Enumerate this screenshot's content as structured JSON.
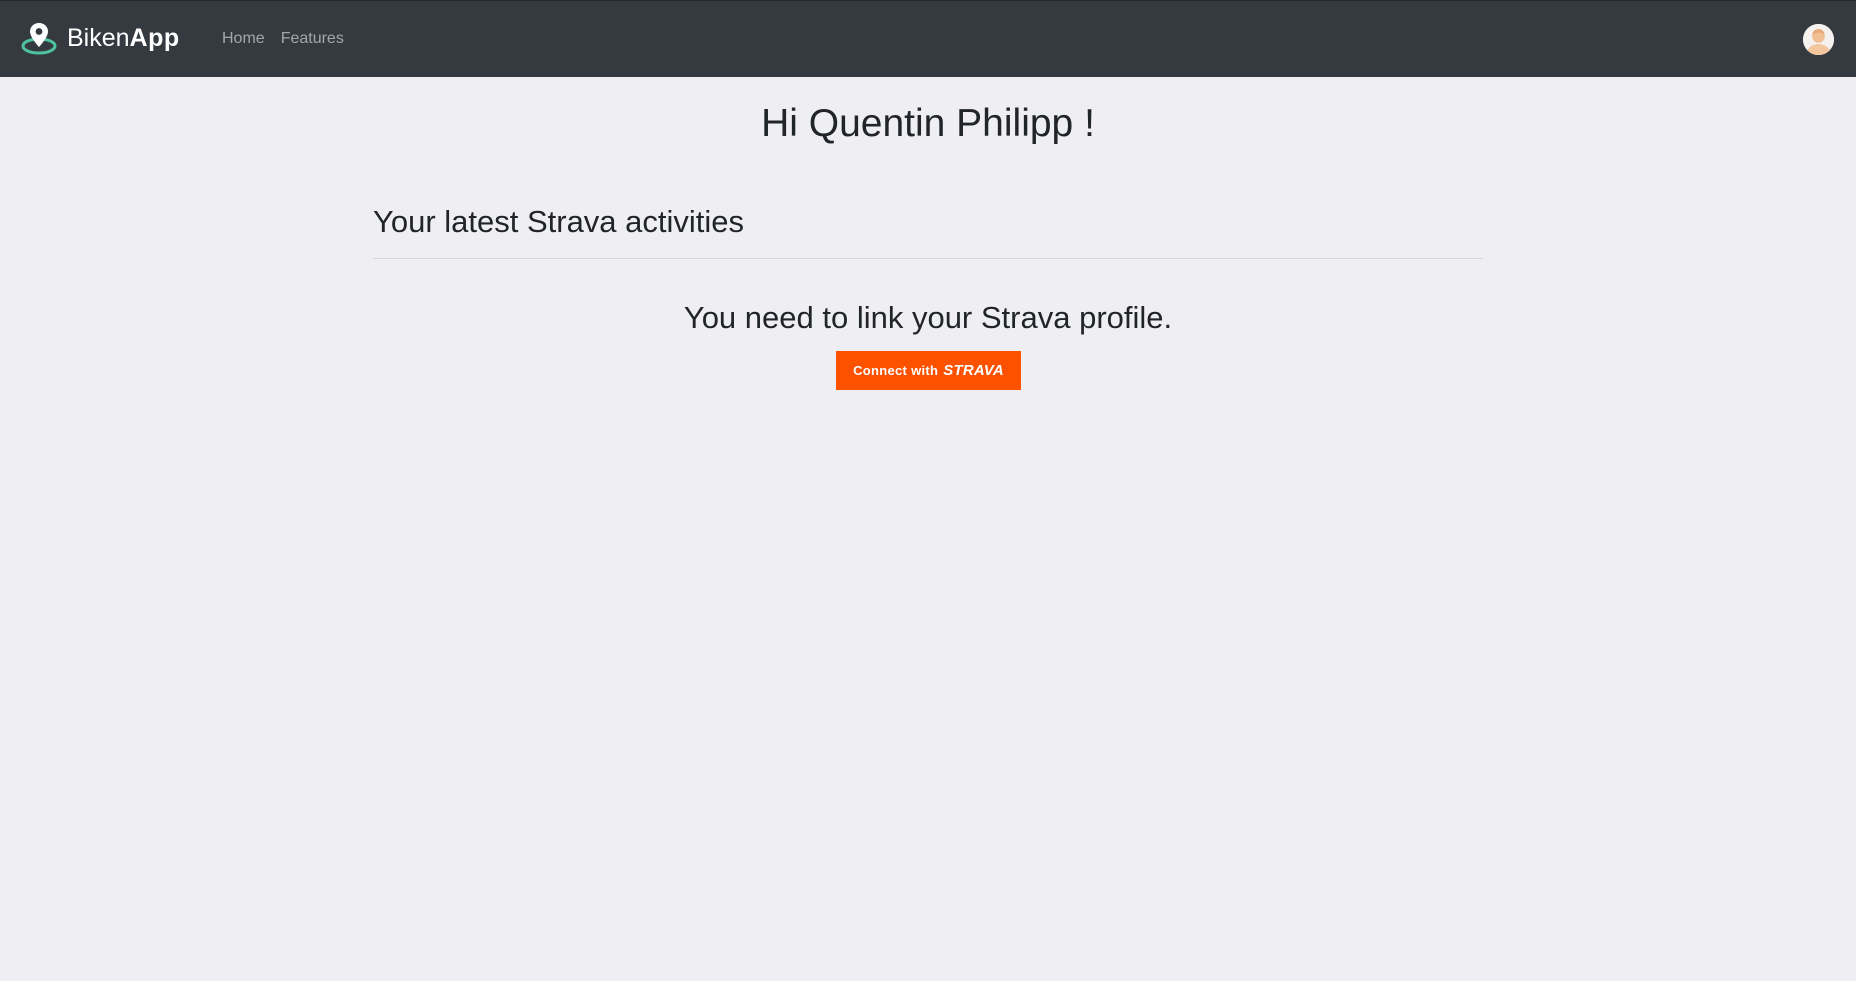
{
  "navbar": {
    "brand": {
      "name_regular": "Biken",
      "name_bold": "App",
      "logo_icon": "map-pin-icon"
    },
    "links": [
      {
        "label": "Home"
      },
      {
        "label": "Features"
      }
    ],
    "avatar_icon": "user-avatar-icon"
  },
  "main": {
    "greeting": "Hi Quentin Philipp !",
    "section_title": "Your latest Strava activities",
    "notice": "You need to link your Strava profile.",
    "connect_button": {
      "prefix": "Connect with",
      "wordmark": "STRAVA"
    }
  },
  "colors": {
    "navbar_bg": "#343a40",
    "page_bg": "#efeff3",
    "strava_orange": "#fc5200",
    "brand_accent": "#4fc3a1"
  }
}
